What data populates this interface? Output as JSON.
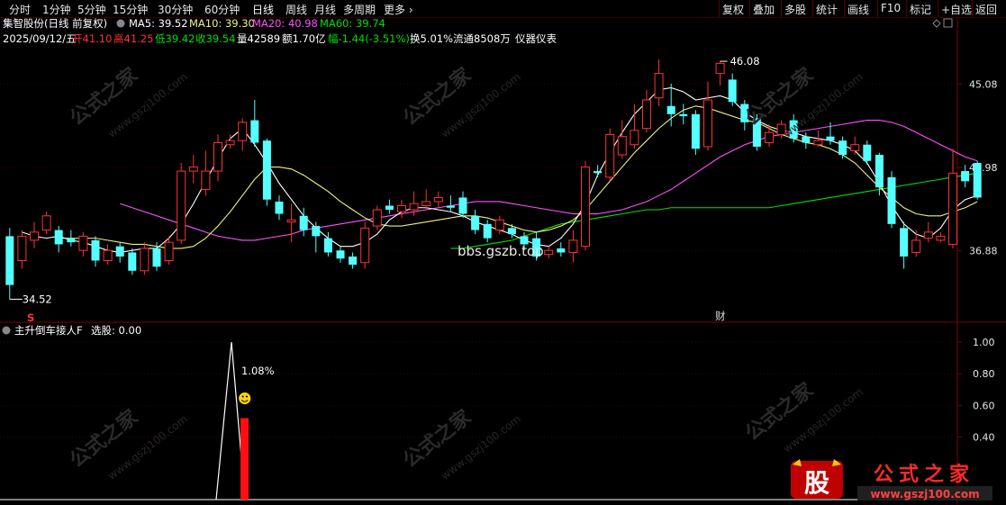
{
  "toolbar": {
    "left": [
      "分时",
      "1分钟",
      "5分钟",
      "15分钟",
      "30分钟",
      "60分钟",
      "日线",
      "周线",
      "月线",
      "多周期",
      "更多"
    ],
    "right": [
      "复权",
      "叠加",
      "多股",
      "统计",
      "画线",
      "F10",
      "标记",
      "+自选",
      "返回"
    ],
    "selected": "日线"
  },
  "header": {
    "stock": "集智股份(日线 前复权)",
    "ma5": "MA5: 39.52",
    "ma10": "MA10: 39.30",
    "ma20": "MA20: 40.98",
    "ma60": "MA60: 39.74",
    "date": "2025/09/12/五",
    "open": "开41.10",
    "high": "高41.25",
    "low": "低39.42",
    "close": "收39.54",
    "vol": "量42589",
    "amount": "额1.70亿",
    "change": "幅-1.44(-3.51%)",
    "turnover": "换5.01%",
    "float": "流通8508万",
    "industry": "仪器仪表"
  },
  "price_axis": [
    "45.08",
    "40.98",
    "36.88"
  ],
  "annotations": {
    "high_label": "46.08",
    "low_label": "34.52",
    "s_marker": "S",
    "cai_marker": "财",
    "watermark_site": "bbs.gszb.top"
  },
  "indicator": {
    "name": "主升倒车接人F",
    "value": "选股: 0.00",
    "axis": [
      "1.00",
      "0.80",
      "0.60",
      "0.40"
    ],
    "pct_label": "1.08%",
    "smiley": "☻"
  },
  "logo": {
    "main": "公式之家",
    "sub": "www.gszj100.com",
    "badge": "股"
  },
  "watermark_text": "公式之家",
  "watermark_url": "www.gszj100.com",
  "colors": {
    "up": "#ff3232",
    "down": "#54ffff",
    "ma5": "#ffffff",
    "ma10": "#f0f080",
    "ma20": "#ff50ff",
    "ma60": "#00e000",
    "axis_red": "#800000",
    "signal": "#ff1010"
  },
  "chart_data": {
    "type": "candlestick",
    "price_range": [
      33.5,
      47.0
    ],
    "candles": [
      [
        37.6,
        35.2,
        38.0,
        34.5
      ],
      [
        36.4,
        37.6,
        37.9,
        36.0
      ],
      [
        37.4,
        37.8,
        38.3,
        37.0
      ],
      [
        37.9,
        38.6,
        38.8,
        37.7
      ],
      [
        37.9,
        37.2,
        38.1,
        36.8
      ],
      [
        37.5,
        37.3,
        37.9,
        37.1
      ],
      [
        36.9,
        37.6,
        37.8,
        36.6
      ],
      [
        37.4,
        36.4,
        37.6,
        36.1
      ],
      [
        36.4,
        36.9,
        37.2,
        36.2
      ],
      [
        37.1,
        36.6,
        37.3,
        36.3
      ],
      [
        36.8,
        35.9,
        37.0,
        35.7
      ],
      [
        35.9,
        37.0,
        37.3,
        35.7
      ],
      [
        37.0,
        36.1,
        37.3,
        35.9
      ],
      [
        36.4,
        37.3,
        37.6,
        36.2
      ],
      [
        37.4,
        40.8,
        41.2,
        37.2
      ],
      [
        40.8,
        41.0,
        41.6,
        40.2
      ],
      [
        39.9,
        40.8,
        41.8,
        39.6
      ],
      [
        40.8,
        42.2,
        42.6,
        40.3
      ],
      [
        42.1,
        42.3,
        42.6,
        41.9
      ],
      [
        42.3,
        43.2,
        43.4,
        41.8
      ],
      [
        43.3,
        42.2,
        44.3,
        42.0
      ],
      [
        42.3,
        39.4,
        42.4,
        39.1
      ],
      [
        39.3,
        38.7,
        39.6,
        38.4
      ],
      [
        38.3,
        38.4,
        39.2,
        37.3
      ],
      [
        38.6,
        37.9,
        39.0,
        37.6
      ],
      [
        38.1,
        37.6,
        38.3,
        36.8
      ],
      [
        37.5,
        36.8,
        37.8,
        36.6
      ],
      [
        36.9,
        36.5,
        37.1,
        36.3
      ],
      [
        36.6,
        36.2,
        36.8,
        36.0
      ],
      [
        36.3,
        38.0,
        38.3,
        36.0
      ],
      [
        38.1,
        38.9,
        39.1,
        37.9
      ],
      [
        39.1,
        38.9,
        39.4,
        38.7
      ],
      [
        38.8,
        39.1,
        39.4,
        38.5
      ],
      [
        38.9,
        39.2,
        39.8,
        38.6
      ],
      [
        39.1,
        39.3,
        39.9,
        38.9
      ],
      [
        39.3,
        39.5,
        39.8,
        39.0
      ],
      [
        39.1,
        39.0,
        39.6,
        38.8
      ],
      [
        39.5,
        38.7,
        39.8,
        38.5
      ],
      [
        38.6,
        37.9,
        38.9,
        37.7
      ],
      [
        38.2,
        37.5,
        38.4,
        37.3
      ],
      [
        37.9,
        38.4,
        38.6,
        37.7
      ],
      [
        38.0,
        37.7,
        38.2,
        37.5
      ],
      [
        37.6,
        37.2,
        37.8,
        36.9
      ],
      [
        37.5,
        36.6,
        37.8,
        36.4
      ],
      [
        36.7,
        36.9,
        37.1,
        36.5
      ],
      [
        37.0,
        36.8,
        37.3,
        36.6
      ],
      [
        36.8,
        37.4,
        37.9,
        36.3
      ],
      [
        37.1,
        41.0,
        41.3,
        36.9
      ],
      [
        40.8,
        40.7,
        41.1,
        40.5
      ],
      [
        40.5,
        42.6,
        42.9,
        40.3
      ],
      [
        41.6,
        42.5,
        43.3,
        41.4
      ],
      [
        42.1,
        42.8,
        44.1,
        41.9
      ],
      [
        42.9,
        44.3,
        44.8,
        42.7
      ],
      [
        44.4,
        45.6,
        46.3,
        44.0
      ],
      [
        44.0,
        43.6,
        45.1,
        43.0
      ],
      [
        43.6,
        43.5,
        44.1,
        43.1
      ],
      [
        43.6,
        41.9,
        43.8,
        41.6
      ],
      [
        42.0,
        44.3,
        45.2,
        41.8
      ],
      [
        45.6,
        46.1,
        46.2,
        45.0
      ],
      [
        45.3,
        44.2,
        45.6,
        44.0
      ],
      [
        44.1,
        43.2,
        44.3,
        42.8
      ],
      [
        43.4,
        42.0,
        43.6,
        41.8
      ],
      [
        42.2,
        42.7,
        43.1,
        42.0
      ],
      [
        42.6,
        43.1,
        43.3,
        42.4
      ],
      [
        43.3,
        42.4,
        43.6,
        42.2
      ],
      [
        42.5,
        42.2,
        42.7,
        41.9
      ],
      [
        42.1,
        42.3,
        42.8,
        42.0
      ],
      [
        42.5,
        42.3,
        43.2,
        42.1
      ],
      [
        42.3,
        41.6,
        42.5,
        41.4
      ],
      [
        41.8,
        42.1,
        42.5,
        41.6
      ],
      [
        42.1,
        41.3,
        42.3,
        41.1
      ],
      [
        41.6,
        40.0,
        41.7,
        39.6
      ],
      [
        40.5,
        38.2,
        40.8,
        38.0
      ],
      [
        38.0,
        36.6,
        38.3,
        36.0
      ],
      [
        36.8,
        37.4,
        37.9,
        36.6
      ],
      [
        37.5,
        37.8,
        38.3,
        37.3
      ],
      [
        37.4,
        37.6,
        37.8,
        37.3
      ],
      [
        37.2,
        40.7,
        41.9,
        37.0
      ],
      [
        40.8,
        40.3,
        41.1,
        40.0
      ],
      [
        41.2,
        39.5,
        41.3,
        39.4
      ]
    ],
    "ma5": [
      37.8,
      37.6,
      37.5,
      37.6,
      37.4,
      37.3,
      37.1,
      36.9,
      36.8,
      36.9,
      37.0,
      37.0,
      37.5,
      38.2,
      39.2,
      40.3,
      41.4,
      42.4,
      42.9,
      42.1,
      41.2,
      40.2,
      39.4,
      38.6,
      38.0,
      37.5,
      37.1,
      37.1,
      37.3,
      37.7,
      38.4,
      38.8,
      39.0,
      39.0,
      38.9,
      38.8,
      38.6,
      38.3,
      38.1,
      37.9,
      37.7,
      37.4,
      37.2,
      37.1,
      37.5,
      38.2,
      39.2,
      40.6,
      41.7,
      42.7,
      43.6,
      44.2,
      44.8,
      44.9,
      44.7,
      44.3,
      44.4,
      44.5,
      44.3,
      43.7,
      43.3,
      43.0,
      42.8,
      42.7,
      42.5,
      42.4,
      42.3,
      42.1,
      41.8,
      41.2,
      40.2,
      39.1,
      38.2,
      37.7,
      37.5,
      38.0,
      38.9,
      39.4,
      39.6
    ],
    "ma10": [
      37.5,
      37.5,
      37.5,
      37.5,
      37.4,
      37.3,
      37.2,
      37.2,
      37.1,
      37.0,
      37.0,
      37.1,
      37.5,
      38.1,
      38.8,
      39.6,
      40.4,
      41.0,
      41.0,
      40.9,
      40.6,
      40.2,
      39.8,
      39.3,
      38.9,
      38.5,
      38.2,
      38.1,
      38.1,
      38.2,
      38.3,
      38.4,
      38.5,
      38.6,
      38.6,
      38.5,
      38.3,
      38.1,
      37.9,
      37.8,
      37.9,
      38.1,
      38.4,
      38.9,
      39.6,
      40.3,
      41.0,
      41.7,
      42.3,
      42.9,
      43.4,
      43.8,
      44.0,
      43.9,
      43.7,
      43.5,
      43.3,
      43.2,
      42.9,
      42.6,
      42.4,
      42.2,
      42.1,
      41.9,
      41.6,
      41.2,
      40.6,
      40.0,
      39.5,
      39.0,
      38.7,
      38.6,
      38.6,
      38.8,
      39.0,
      39.3
    ],
    "ma20": [
      39.2,
      39.0,
      38.8,
      38.6,
      38.4,
      38.2,
      38.0,
      37.8,
      37.6,
      37.5,
      37.4,
      37.4,
      37.5,
      37.6,
      37.7,
      37.9,
      38.0,
      38.1,
      38.2,
      38.3,
      38.4,
      38.5,
      38.6,
      38.7,
      38.8,
      38.9,
      39.0,
      39.1,
      39.2,
      39.3,
      39.3,
      39.3,
      39.2,
      39.1,
      39.0,
      38.9,
      38.8,
      38.7,
      38.7,
      38.7,
      38.8,
      38.9,
      39.1,
      39.3,
      39.6,
      39.9,
      40.3,
      40.7,
      41.1,
      41.5,
      41.8,
      42.1,
      42.3,
      42.5,
      42.6,
      42.7,
      42.8,
      42.9,
      43.0,
      43.1,
      43.2,
      43.3,
      43.3,
      43.2,
      43.0,
      42.7,
      42.4,
      42.1,
      41.8,
      41.5,
      41.3
    ],
    "ma60": [
      37.0,
      37.0,
      37.1,
      37.2,
      37.3,
      37.4,
      37.6,
      37.8,
      38.0,
      38.2,
      38.3,
      38.4,
      38.5,
      38.6,
      38.7,
      38.8,
      38.9,
      38.9,
      39.0,
      39.0,
      39.0,
      39.0,
      39.0,
      39.0,
      39.0,
      39.0,
      39.0,
      39.1,
      39.2,
      39.3,
      39.4,
      39.5,
      39.6,
      39.7,
      39.8,
      39.9,
      40.0,
      40.1,
      40.2,
      40.3,
      40.4,
      40.5,
      40.6,
      40.7
    ],
    "indicator": {
      "signal_bars": [
        {
          "index": 22,
          "value": 0.52
        }
      ],
      "range": [
        0,
        1.0
      ]
    }
  }
}
